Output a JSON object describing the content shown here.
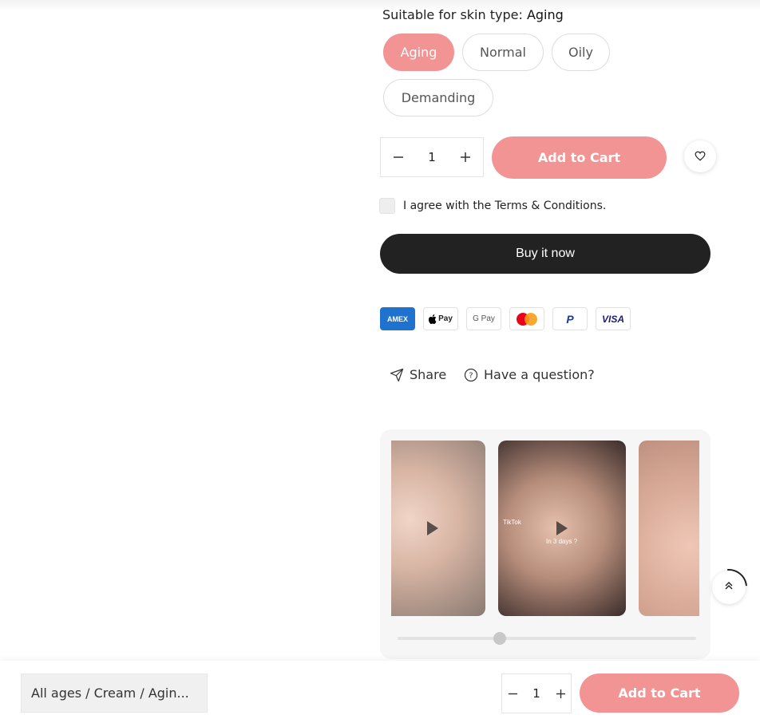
{
  "skin_type": {
    "label": "Suitable for skin type:",
    "selected": "Aging",
    "options": [
      "Aging",
      "Normal",
      "Oily",
      "Demanding"
    ]
  },
  "quantity": {
    "value": "1",
    "decrease_icon": "minus-icon",
    "increase_icon": "plus-icon"
  },
  "add_to_cart_label": "Add to Cart",
  "wishlist_icon": "heart-icon",
  "terms": {
    "text": "I agree with the Terms & Conditions."
  },
  "buy_now_label": "Buy it now",
  "payments": {
    "amex": "AMEX",
    "applepay": "Pay",
    "gpay": "G Pay",
    "paypal": "P",
    "visa": "VISA"
  },
  "share_label": "Share",
  "question_label": "Have a question?",
  "videos": {
    "v2_tiktok": "TikTok",
    "v2_caption": "In 3 days ?"
  },
  "sticky": {
    "variant": "All ages / Cream / Agin...",
    "quantity": "1",
    "add_to_cart_label": "Add to Cart"
  },
  "colors": {
    "accent": "#f39494",
    "dark_button": "#222222"
  }
}
